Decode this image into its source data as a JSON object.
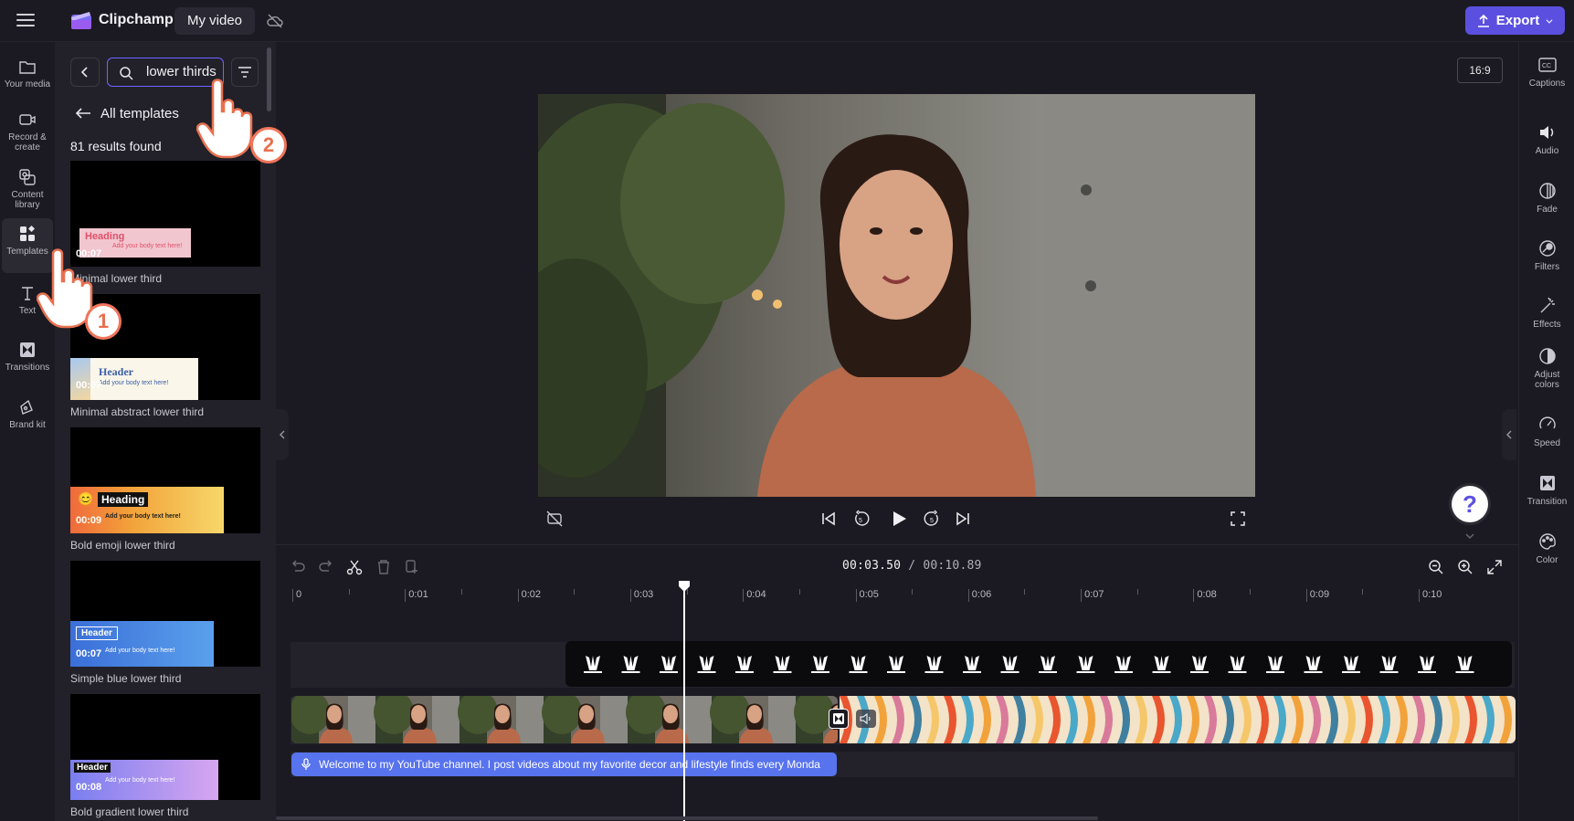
{
  "app": {
    "brand": "Clipchamp",
    "video_name": "My video",
    "export_label": "Export"
  },
  "left_rail": [
    {
      "label": "Your media",
      "icon": "folder-icon"
    },
    {
      "label": "Record & create",
      "icon": "camera-icon"
    },
    {
      "label": "Content library",
      "icon": "library-icon"
    },
    {
      "label": "Templates",
      "icon": "templates-icon"
    },
    {
      "label": "Text",
      "icon": "text-icon"
    },
    {
      "label": "Transitions",
      "icon": "transitions-icon"
    },
    {
      "label": "Brand kit",
      "icon": "brand-kit-icon"
    }
  ],
  "search": {
    "value": "lower thirds",
    "placeholder": "Search"
  },
  "panel": {
    "back_link": "All templates",
    "results": "81 results found"
  },
  "templates": [
    {
      "title": "Minimal lower third",
      "duration": "00:07",
      "heading": "Heading",
      "body": "Add your body text here!"
    },
    {
      "title": "Minimal abstract lower third",
      "duration": "00:07",
      "heading": "Header",
      "body": "Add your body text here!"
    },
    {
      "title": "Bold emoji lower third",
      "duration": "00:09",
      "heading": "Heading",
      "body": "Add your body text here!"
    },
    {
      "title": "Simple blue lower third",
      "duration": "00:07",
      "heading": "Header",
      "body": "Add your body text here!"
    },
    {
      "title": "Bold gradient lower third",
      "duration": "00:08",
      "heading": "Header",
      "body": "Add your body text here!"
    }
  ],
  "preview": {
    "aspect_ratio": "16:9"
  },
  "right_rail": [
    {
      "label": "Captions",
      "icon": "captions-icon"
    },
    {
      "label": "Audio",
      "icon": "audio-icon"
    },
    {
      "label": "Fade",
      "icon": "fade-icon"
    },
    {
      "label": "Filters",
      "icon": "filters-icon"
    },
    {
      "label": "Effects",
      "icon": "effects-icon"
    },
    {
      "label": "Adjust colors",
      "icon": "adjust-colors-icon"
    },
    {
      "label": "Speed",
      "icon": "speed-icon"
    },
    {
      "label": "Transition",
      "icon": "transition-icon"
    },
    {
      "label": "Color",
      "icon": "color-icon"
    }
  ],
  "timeline": {
    "current_time": "00:03.50",
    "separator": "/",
    "total_time": "00:10.89",
    "ticks": [
      "0",
      "0:01",
      "0:02",
      "0:03",
      "0:04",
      "0:05",
      "0:06",
      "0:07",
      "0:08",
      "0:09",
      "0:10"
    ],
    "caption_text": "Welcome to my YouTube channel. I post videos about my favorite decor and lifestyle finds every Monda"
  },
  "overlays": {
    "step1": "1",
    "step2": "2"
  },
  "colors": {
    "accent": "#5b4fe0",
    "caption_clip": "#5873ee",
    "step_badge": "#f0755a"
  }
}
